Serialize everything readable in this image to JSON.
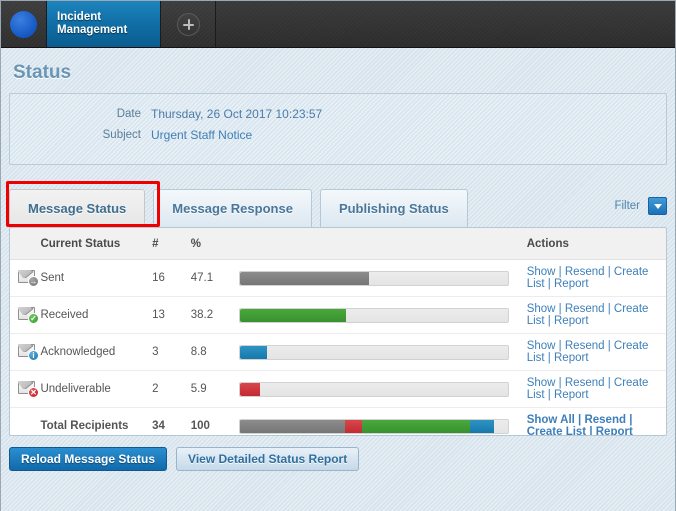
{
  "window": {
    "app_tab_label": "Incident\nManagement",
    "add_tab_icon": "plus-icon",
    "logo_icon": "app-logo-icon"
  },
  "page": {
    "title": "Status"
  },
  "details": {
    "date_label": "Date",
    "date_value": "Thursday, 26 Oct 2017 10:23:57",
    "subject_label": "Subject",
    "subject_value": "Urgent Staff Notice"
  },
  "tabs": {
    "items": [
      {
        "label": "Message Status",
        "active": true
      },
      {
        "label": "Message Response",
        "active": false
      },
      {
        "label": "Publishing Status",
        "active": false
      }
    ],
    "filter_label": "Filter",
    "filter_icon": "chevron-down-icon"
  },
  "table": {
    "headers": {
      "status": "Current Status",
      "count": "#",
      "percent": "%",
      "bar": "",
      "actions": "Actions"
    },
    "rows": [
      {
        "icon": "envelope-sent-icon",
        "badge": "→",
        "badge_class": "sent",
        "status": "Sent",
        "count": "16",
        "percent": "47.1",
        "bar_pct": 48.0,
        "bar_class": "f-gray",
        "actions": [
          "Show",
          "Resend",
          "Create List",
          "Report"
        ]
      },
      {
        "icon": "envelope-received-icon",
        "badge": "✓",
        "badge_class": "recv",
        "status": "Received",
        "count": "13",
        "percent": "38.2",
        "bar_pct": 39.5,
        "bar_class": "f-green",
        "actions": [
          "Show",
          "Resend",
          "Create List",
          "Report"
        ]
      },
      {
        "icon": "envelope-acknowledged-icon",
        "badge": "i",
        "badge_class": "ack",
        "status": "Acknowledged",
        "count": "3",
        "percent": "8.8",
        "bar_pct": 10.0,
        "bar_class": "f-blue",
        "actions": [
          "Show",
          "Resend",
          "Create List",
          "Report"
        ]
      },
      {
        "icon": "envelope-undeliverable-icon",
        "badge": "✕",
        "badge_class": "undel",
        "status": "Undeliverable",
        "count": "2",
        "percent": "5.9",
        "bar_pct": 7.5,
        "bar_class": "f-red",
        "actions": [
          "Show",
          "Resend",
          "Create List",
          "Report"
        ]
      }
    ],
    "total_row": {
      "status": "Total Recipients",
      "count": "34",
      "percent": "100",
      "segments": [
        {
          "class": "f-gray",
          "pct": 39.0
        },
        {
          "class": "f-red",
          "pct": 6.5
        },
        {
          "class": "f-green",
          "pct": 40.5
        },
        {
          "class": "f-blue",
          "pct": 9.0
        }
      ],
      "actions": [
        "Show All",
        "Resend",
        "Create List",
        "Report"
      ]
    }
  },
  "footer": {
    "reload_label": "Reload Message Status",
    "report_label": "View Detailed Status Report"
  },
  "colors": {
    "sent": "#808080",
    "received": "#3d9e35",
    "acknowledged": "#1f87b4",
    "undeliverable": "#cc3035",
    "accent": "#1169ab",
    "highlight": "#ee0000"
  }
}
